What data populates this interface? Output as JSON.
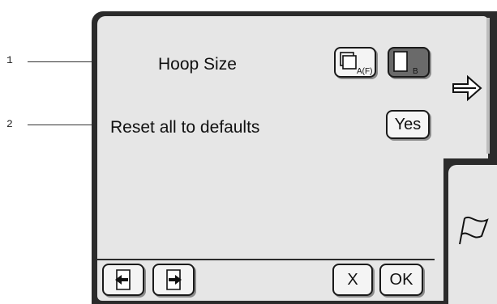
{
  "callouts": [
    {
      "number": "1"
    },
    {
      "number": "2"
    }
  ],
  "settings": {
    "hoop_size": {
      "label": "Hoop Size",
      "option_a_label": "A(F)",
      "option_b_label": "B",
      "option_a_icon": "hoop-af-icon",
      "option_b_icon": "hoop-b-icon",
      "selected": "B"
    },
    "reset": {
      "label": "Reset all to defaults",
      "button_label": "Yes"
    }
  },
  "side_tabs": {
    "next_icon": "arrow-right-icon",
    "flag_icon": "flag-icon"
  },
  "footer": {
    "prev_page_icon": "page-back-icon",
    "next_page_icon": "page-forward-icon",
    "cancel_label": "X",
    "ok_label": "OK"
  },
  "colors": {
    "panel": "#e6e6e6",
    "frame": "#2b2b2b",
    "selected_button": "#6a6a6a"
  }
}
